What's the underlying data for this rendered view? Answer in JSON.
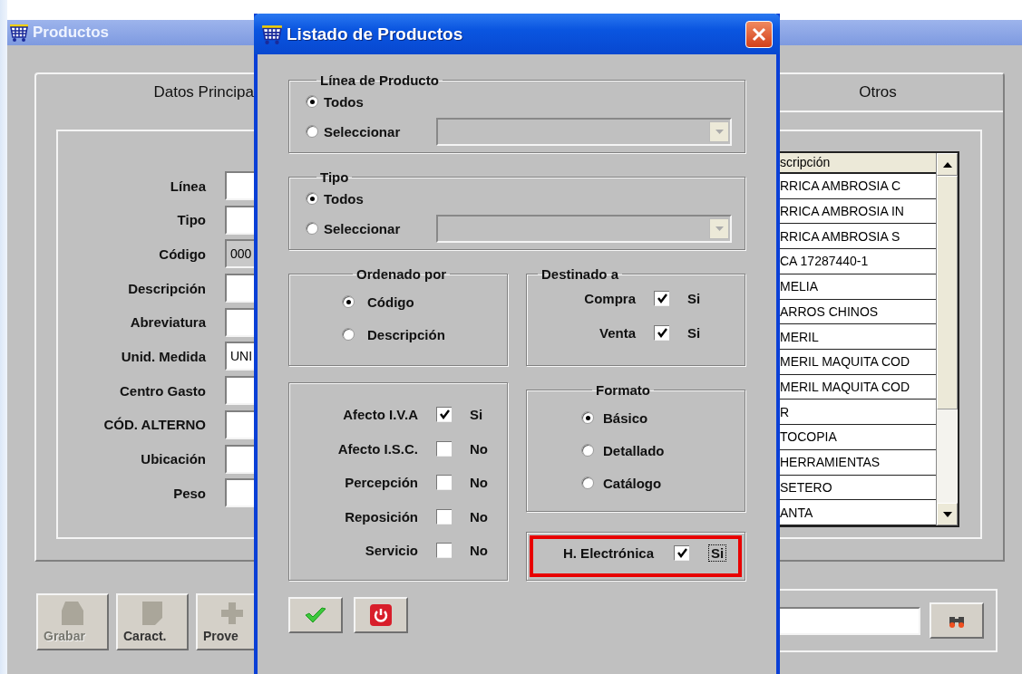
{
  "main_window": {
    "title": "Productos",
    "tabs": [
      {
        "label": "Datos Principa",
        "selected": true
      },
      {
        "label": "Otros",
        "selected": false
      }
    ],
    "fields": [
      {
        "label": "Línea",
        "disabled": false
      },
      {
        "label": "Tipo",
        "disabled": false
      },
      {
        "label": "Código",
        "value": "000",
        "disabled": true
      },
      {
        "label": "Descripción",
        "disabled": false
      },
      {
        "label": "Abreviatura",
        "disabled": false
      },
      {
        "label": "Unid. Medida",
        "value": "UNI",
        "disabled": false
      },
      {
        "label": "Centro Gasto",
        "disabled": false
      },
      {
        "label": "CÓD. ALTERNO",
        "disabled": false
      },
      {
        "label": "Ubicación",
        "disabled": false
      },
      {
        "label": "Peso",
        "disabled": false
      }
    ],
    "table": {
      "columns": [
        "scripción"
      ],
      "rows": [
        "RRICA AMBROSIA C",
        "RRICA AMBROSIA IN",
        "RRICA AMBROSIA S",
        "CA 17287440-1",
        "MELIA",
        "ARROS CHINOS",
        "MERIL",
        "MERIL MAQUITA COD",
        "MERIL MAQUITA COD",
        "R",
        "TOCOPIA",
        "HERRAMIENTAS",
        "SETERO",
        "ANTA"
      ]
    },
    "buttons": [
      {
        "kind": "save",
        "label": "Grabar",
        "disabled": true
      },
      {
        "kind": "features",
        "label": "Caract.",
        "disabled": false
      },
      {
        "kind": "add",
        "label": "Prove",
        "disabled": false
      }
    ]
  },
  "dialog": {
    "title": "Listado de Productos",
    "line_group": {
      "title": "Línea de Producto",
      "options": [
        {
          "label": "Todos",
          "selected": true
        },
        {
          "label": "Seleccionar",
          "selected": false
        }
      ],
      "select_disabled": true
    },
    "type_group": {
      "title": "Tipo",
      "options": [
        {
          "label": "Todos",
          "selected": true
        },
        {
          "label": "Seleccionar",
          "selected": false
        }
      ],
      "select_disabled": true
    },
    "order_group": {
      "title": "Ordenado por",
      "options": [
        {
          "label": "Código",
          "selected": true
        },
        {
          "label": "Descripción",
          "selected": false
        }
      ]
    },
    "target_group": {
      "title": "Destinado a",
      "items": [
        {
          "label": "Compra",
          "checked": true,
          "value": "Si"
        },
        {
          "label": "Venta",
          "checked": true,
          "value": "Si"
        }
      ]
    },
    "flags_group": {
      "items": [
        {
          "label": "Afecto I.V.A",
          "checked": true,
          "value": "Si"
        },
        {
          "label": "Afecto I.S.C.",
          "checked": false,
          "value": "No"
        },
        {
          "label": "Percepción",
          "checked": false,
          "value": "No"
        },
        {
          "label": "Reposición",
          "checked": false,
          "value": "No"
        },
        {
          "label": "Servicio",
          "checked": false,
          "value": "No"
        }
      ]
    },
    "format_group": {
      "title": "Formato",
      "options": [
        {
          "label": "Básico",
          "selected": true
        },
        {
          "label": "Detallado",
          "selected": false
        },
        {
          "label": "Catálogo",
          "selected": false
        }
      ]
    },
    "e_invoice": {
      "label": "H. Electrónica",
      "checked": true,
      "value": "Si",
      "focused": true,
      "highlighted": true
    },
    "buttons": [
      {
        "kind": "accept"
      },
      {
        "kind": "exit"
      }
    ]
  }
}
